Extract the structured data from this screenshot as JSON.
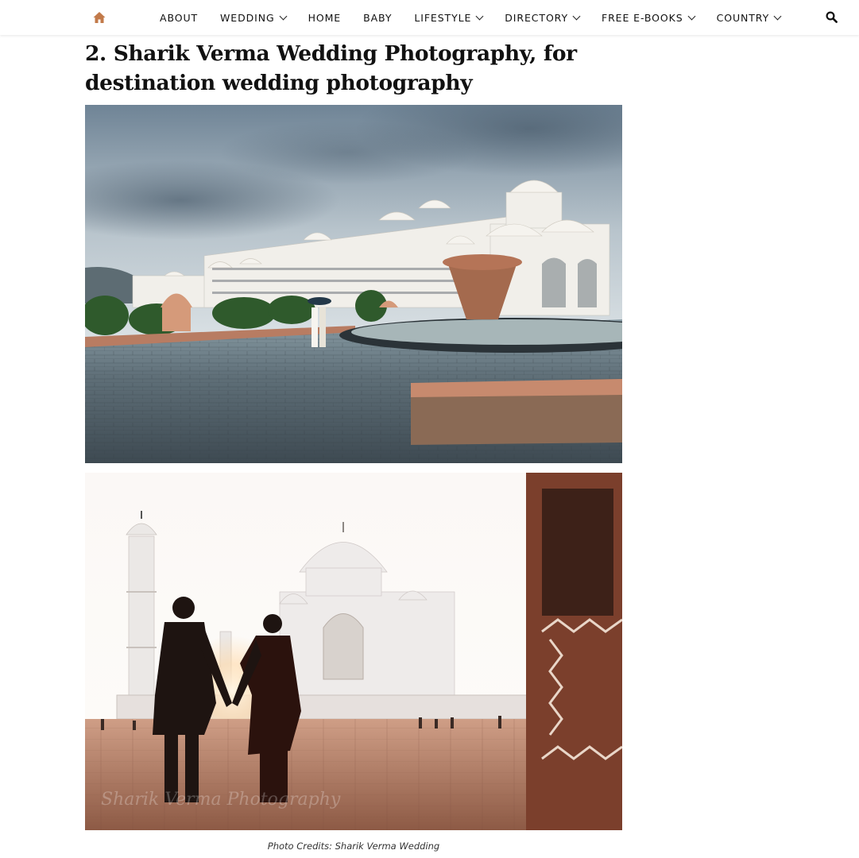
{
  "nav": {
    "items": [
      {
        "label": "ABOUT",
        "dropdown": false
      },
      {
        "label": "WEDDING",
        "dropdown": true
      },
      {
        "label": "HOME",
        "dropdown": false
      },
      {
        "label": "BABY",
        "dropdown": false
      },
      {
        "label": "LIFESTYLE",
        "dropdown": true
      },
      {
        "label": "DIRECTORY",
        "dropdown": true
      },
      {
        "label": "FREE E-BOOKS",
        "dropdown": true
      },
      {
        "label": "COUNTRY",
        "dropdown": true
      }
    ],
    "home_icon": "home-icon",
    "search_icon": "search-icon",
    "accent_color": "#c27a4a"
  },
  "article": {
    "headline": "2. Sharik Verma Wedding Photography, for destination wedding photography",
    "photo1_subject": "palace-wedding-photo",
    "photo2_subject": "taj-mahal-couple-photo",
    "watermark": "Sharik Verma Photography",
    "caption": "Photo Credits: Sharik Verma Wedding"
  }
}
